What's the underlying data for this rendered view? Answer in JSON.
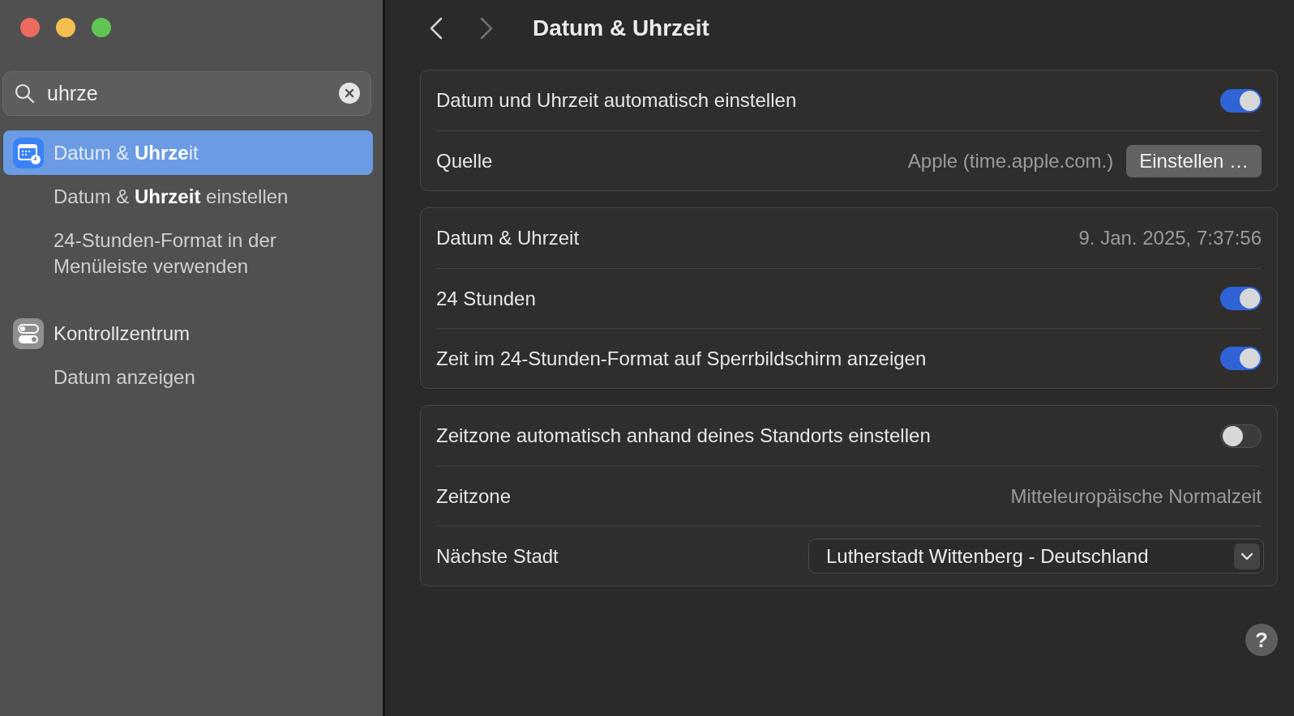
{
  "sidebar": {
    "search": {
      "value": "uhrze"
    },
    "results": [
      {
        "label": "Datum & **Uhrze**it",
        "selected": true,
        "children": [
          {
            "label": "Datum & **Uhrzeit** einstellen"
          },
          {
            "label": "24-Stunden-Format in der Menüleiste verwenden"
          }
        ]
      },
      {
        "label": "Kontrollzentrum",
        "selected": false,
        "children": [
          {
            "label": "Datum anzeigen"
          }
        ]
      }
    ]
  },
  "toolbar": {
    "back": {
      "disabled": false
    },
    "forward": {
      "disabled": true
    },
    "title": "Datum & Uhrzeit"
  },
  "groups": [
    {
      "rows": [
        {
          "kind": "toggle",
          "label": "Datum und Uhrzeit automatisch einstellen",
          "on": true
        },
        {
          "kind": "value_button",
          "label": "Quelle",
          "value": "Apple (time.apple.com.)",
          "button": "Einstellen …"
        }
      ]
    },
    {
      "rows": [
        {
          "kind": "value",
          "label": "Datum & Uhrzeit",
          "value": "9. Jan. 2025, 7:37:56"
        },
        {
          "kind": "toggle",
          "label": "24 Stunden",
          "on": true
        },
        {
          "kind": "toggle",
          "label": "Zeit im 24-Stunden-Format auf Sperrbildschirm anzeigen",
          "on": true
        }
      ]
    },
    {
      "rows": [
        {
          "kind": "toggle",
          "label": "Zeitzone automatisch anhand deines Standorts einstellen",
          "on": false
        },
        {
          "kind": "value",
          "label": "Zeitzone",
          "value": "Mitteleuropäische Normalzeit"
        },
        {
          "kind": "popup",
          "label": "Nächste Stadt",
          "value": "Lutherstadt Wittenberg - Deutschland"
        }
      ]
    }
  ],
  "help": {
    "label": "?"
  }
}
